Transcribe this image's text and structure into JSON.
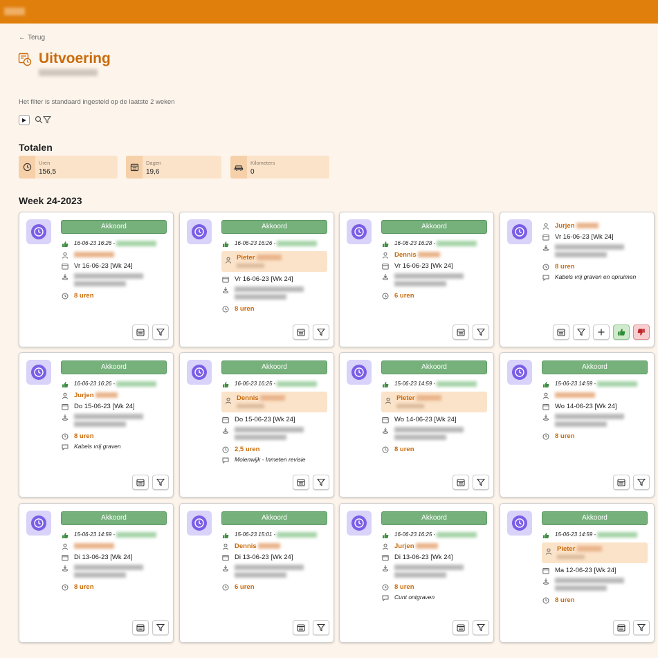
{
  "header": {
    "back": "Terug",
    "title": "Uitvoering",
    "filter_note": "Het filter is standaard ingesteld op de laatste 2 weken"
  },
  "totalen": {
    "title": "Totalen",
    "stats": [
      {
        "label": "Uren",
        "value": "156,5",
        "icon": "clock-icon"
      },
      {
        "label": "Dagen",
        "value": "19,6",
        "icon": "calendar-icon"
      },
      {
        "label": "Kilometers",
        "value": "0",
        "icon": "car-icon"
      }
    ]
  },
  "week": {
    "title": "Week 24-2023"
  },
  "status_label": "Akkoord",
  "cards": [
    {
      "status": "Akkoord",
      "approved": "16-06-23 16:26 -",
      "person": "",
      "person_box": false,
      "date": "Vr 16-06-23 [Wk 24]",
      "hours": "8 uren",
      "note": ""
    },
    {
      "status": "Akkoord",
      "approved": "16-06-23 16:26 -",
      "person": "Pieter",
      "person_box": true,
      "date": "Vr 16-06-23 [Wk 24]",
      "hours": "8 uren",
      "note": ""
    },
    {
      "status": "Akkoord",
      "approved": "16-06-23 16:28 -",
      "person": "Dennis",
      "person_box": false,
      "date": "Vr 16-06-23 [Wk 24]",
      "hours": "6 uren",
      "note": ""
    },
    {
      "status": "",
      "approved": "",
      "person": "Jurjen",
      "person_box": false,
      "date": "Vr 16-06-23 [Wk 24]",
      "hours": "8 uren",
      "note": "Kabels vrij graven en opruimen"
    },
    {
      "status": "Akkoord",
      "approved": "16-06-23 16:26 -",
      "person": "Jurjen",
      "person_box": false,
      "date": "Do 15-06-23 [Wk 24]",
      "hours": "8 uren",
      "note": "Kabels vrij graven"
    },
    {
      "status": "Akkoord",
      "approved": "16-06-23 16:25 -",
      "person": "Dennis",
      "person_box": true,
      "date": "Do 15-06-23 [Wk 24]",
      "hours": "2,5 uren",
      "note": "Molenwijk - Inmeten revisie"
    },
    {
      "status": "Akkoord",
      "approved": "15-06-23 14:59 -",
      "person": "Pieter",
      "person_box": true,
      "date": "Wo 14-06-23 [Wk 24]",
      "hours": "8 uren",
      "note": ""
    },
    {
      "status": "Akkoord",
      "approved": "15-06-23 14:59 -",
      "person": "",
      "person_box": false,
      "date": "Wo 14-06-23 [Wk 24]",
      "hours": "8 uren",
      "note": ""
    },
    {
      "status": "Akkoord",
      "approved": "15-06-23 14:59 -",
      "person": "",
      "person_box": false,
      "date": "Di 13-06-23 [Wk 24]",
      "hours": "8 uren",
      "note": ""
    },
    {
      "status": "Akkoord",
      "approved": "15-06-23 15:01 -",
      "person": "Dennis",
      "person_box": false,
      "date": "Di 13-06-23 [Wk 24]",
      "hours": "6 uren",
      "note": ""
    },
    {
      "status": "Akkoord",
      "approved": "16-06-23 16:25 -",
      "person": "Jurjen",
      "person_box": false,
      "date": "Di 13-06-23 [Wk 24]",
      "hours": "8 uren",
      "note": "Cunt ontgraven"
    },
    {
      "status": "Akkoord",
      "approved": "15-06-23 14:59 -",
      "person": "Pieter",
      "person_box": true,
      "date": "Ma 12-06-23 [Wk 24]",
      "hours": "8 uren",
      "note": ""
    }
  ]
}
